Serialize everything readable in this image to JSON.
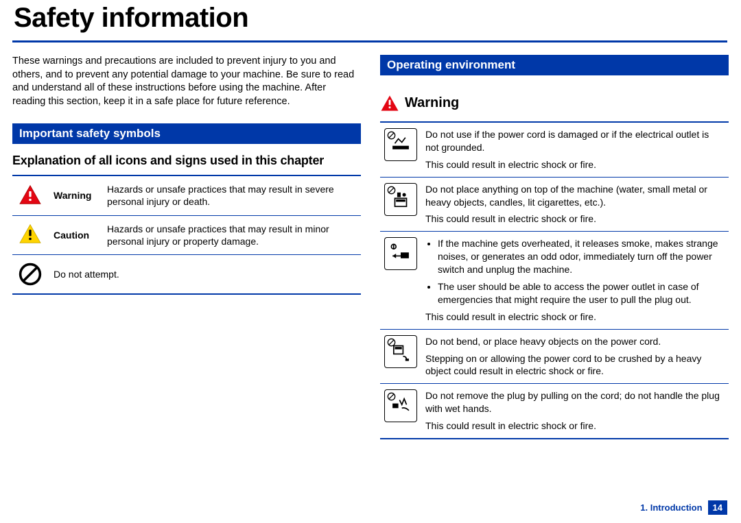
{
  "title": "Safety information",
  "intro": "These warnings and precautions are included to prevent injury to you and others, and to prevent any potential damage to your machine. Be sure to read and understand all of these instructions before using the machine. After reading this section, keep it in a safe place for future reference.",
  "left": {
    "sectionBar": "Important safety symbols",
    "subhead": "Explanation of all icons and signs used in this chapter",
    "symbols": [
      {
        "label": "Warning",
        "desc": "Hazards or unsafe practices that may result in severe personal injury or death."
      },
      {
        "label": "Caution",
        "desc": "Hazards or unsafe practices that may result in minor personal injury or property damage."
      },
      {
        "label": "",
        "desc": "Do not attempt."
      }
    ]
  },
  "right": {
    "sectionBar": "Operating environment",
    "warnHeading": "Warning",
    "rows": [
      {
        "lines": [
          "Do not use if the power cord is damaged or if the electrical outlet is not grounded.",
          "This could result in electric shock or fire."
        ]
      },
      {
        "lines": [
          "Do not place anything on top of the machine (water, small metal or heavy objects, candles, lit cigarettes, etc.).",
          "This could result in electric shock or fire."
        ]
      },
      {
        "bullets": [
          "If the machine gets overheated, it releases smoke, makes strange noises, or generates an odd odor, immediately turn off the power switch and unplug the machine.",
          "The user should be able to access the power outlet in case of emergencies that might require the user to pull the plug out."
        ],
        "after": "This could result in electric shock or fire."
      },
      {
        "lines": [
          "Do not bend, or place heavy objects on the power cord.",
          "Stepping on or allowing the power cord to be crushed by a heavy object could result in electric shock or fire."
        ]
      },
      {
        "lines": [
          "Do not remove the plug by pulling on the cord; do not handle the plug with wet hands.",
          "This could result in electric shock or fire."
        ]
      }
    ]
  },
  "footer": {
    "chapter": "1. Introduction",
    "page": "14"
  }
}
